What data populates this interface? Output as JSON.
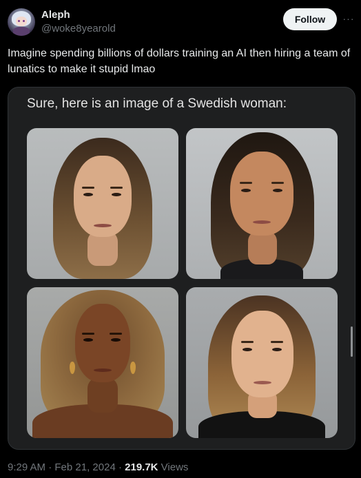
{
  "author": {
    "display_name": "Aleph",
    "handle": "@woke8yearold"
  },
  "actions": {
    "follow_label": "Follow",
    "more_label": "···"
  },
  "tweet": {
    "text": "Imagine spending billions of dollars training an AI then hiring a team of lunatics to make it stupid lmao"
  },
  "media": {
    "caption": "Sure, here is an image of a Swedish woman:"
  },
  "meta": {
    "time": "9:29 AM",
    "separator": " · ",
    "date": "Feb 21, 2024",
    "views_count": "219.7K",
    "views_label": " Views"
  },
  "colors": {
    "background": "#000000",
    "text_primary": "#e7e9ea",
    "text_secondary": "#71767b",
    "follow_bg": "#eff3f4",
    "media_bg": "#1e1f20"
  }
}
